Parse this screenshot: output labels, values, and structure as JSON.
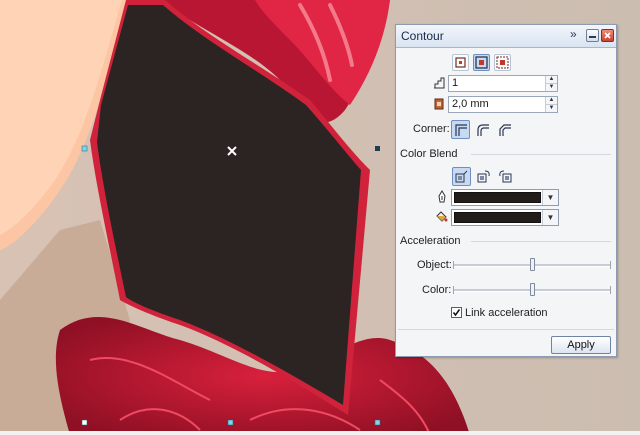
{
  "docker": {
    "title": "Contour",
    "offset_steps": "1",
    "offset_distance": "2,0 mm",
    "corner_label": "Corner:",
    "color_blend_title": "Color Blend",
    "outline_color": "#231d1a",
    "fill_color": "#231d1a",
    "acceleration_title": "Acceleration",
    "object_label": "Object:",
    "color_label": "Color:",
    "object_acceleration": 0.5,
    "color_acceleration": 0.5,
    "link_acceleration_label": "Link acceleration",
    "link_acceleration_checked": true,
    "apply_label": "Apply"
  },
  "icons": {
    "title_bar": [
      "chevron-right-icon",
      "minimize-icon",
      "close-icon"
    ],
    "direction": [
      "to-center-icon",
      "inside-icon",
      "outside-icon"
    ],
    "steps_field": "steps-icon",
    "offset_field": "offset-icon",
    "corner": [
      "mitered-corner-icon",
      "round-corner-icon",
      "bevel-corner-icon"
    ],
    "blend": [
      "linear-blend-icon",
      "clockwise-blend-icon",
      "counterclockwise-blend-icon"
    ],
    "outline_swatch": "pen-icon",
    "fill_swatch": "paint-bucket-icon"
  },
  "colors": {
    "accent": "#c9d9f0",
    "selected_shape_fill": "#2b2422",
    "shape_outline": "#d0233b"
  }
}
